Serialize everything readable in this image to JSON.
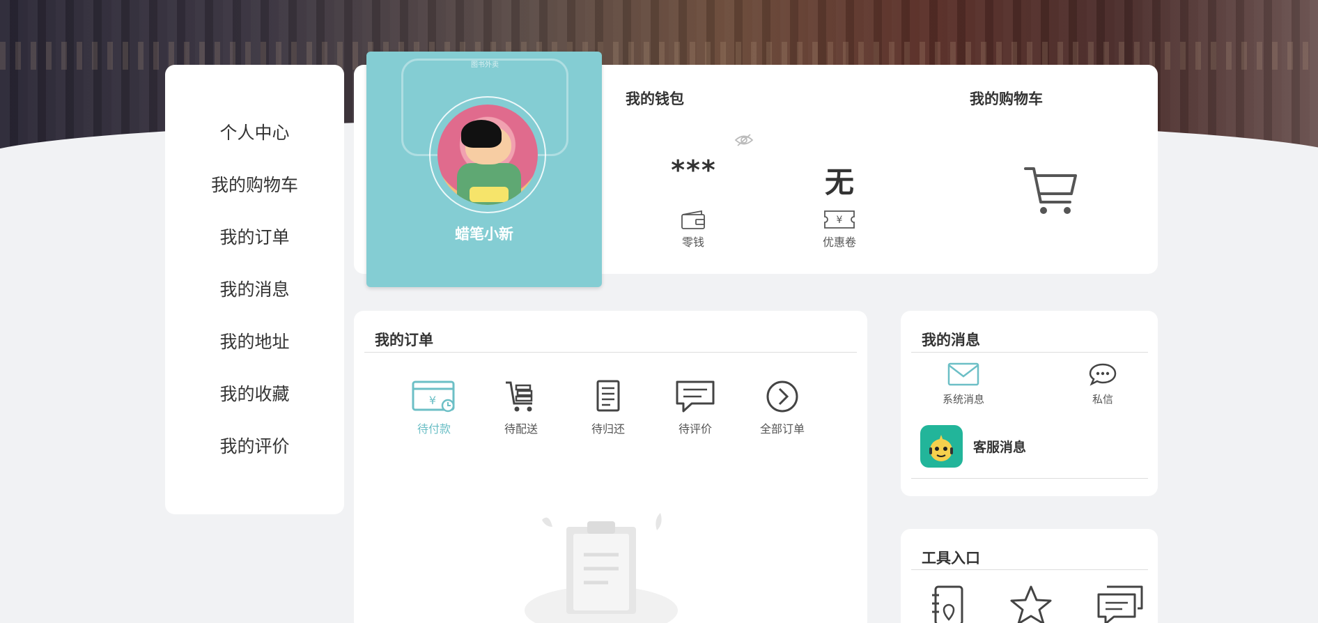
{
  "sidebar": {
    "items": [
      {
        "label": "个人中心"
      },
      {
        "label": "我的购物车"
      },
      {
        "label": "我的订单"
      },
      {
        "label": "我的消息"
      },
      {
        "label": "我的地址"
      },
      {
        "label": "我的收藏"
      },
      {
        "label": "我的评价"
      }
    ]
  },
  "profile": {
    "watermark_text": "图书外卖",
    "username": "蜡笔小新"
  },
  "wallet": {
    "title": "我的钱包",
    "balance_value": "***",
    "balance_label": "零钱",
    "coupon_value": "无",
    "coupon_label": "优惠卷"
  },
  "cart": {
    "title": "我的购物车"
  },
  "orders": {
    "title": "我的订单",
    "tabs": [
      {
        "label": "待付款",
        "icon": "pending-payment-icon",
        "active": true
      },
      {
        "label": "待配送",
        "icon": "cart-delivery-icon"
      },
      {
        "label": "待归还",
        "icon": "return-book-icon"
      },
      {
        "label": "待评价",
        "icon": "comment-icon"
      },
      {
        "label": "全部订单",
        "icon": "arrow-circle-icon"
      }
    ]
  },
  "messages": {
    "title": "我的消息",
    "tabs": [
      {
        "label": "系统消息",
        "icon": "mail-icon"
      },
      {
        "label": "私信",
        "icon": "chat-bubble-icon"
      }
    ],
    "service_label": "客服消息"
  },
  "tools": {
    "title": "工具入口"
  },
  "colors": {
    "accent": "#84cdd3",
    "active_text": "#6cbfc6",
    "service_green": "#22b59a"
  }
}
